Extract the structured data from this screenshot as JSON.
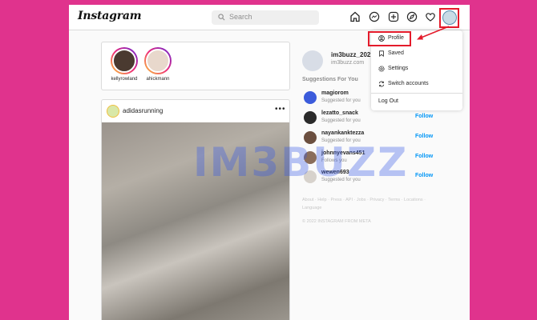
{
  "header": {
    "logo": "Instagram",
    "search_placeholder": "Search"
  },
  "stories": [
    {
      "name": "kellyrowland"
    },
    {
      "name": "ahickmann"
    }
  ],
  "post": {
    "username": "adidasrunning",
    "more": "•••"
  },
  "sidebar": {
    "username": "im3buzz_2021",
    "site": "im3buzz.com",
    "suggestions_title": "Suggestions For You",
    "suggestions": [
      {
        "username": "magiorom",
        "sub": "Suggested for you",
        "follow": "",
        "color": "#3b5bdb"
      },
      {
        "username": "lezatto_snack",
        "sub": "Suggested for you",
        "follow": "Follow",
        "color": "#2a2a2a"
      },
      {
        "username": "nayankanktezza",
        "sub": "Suggested for you",
        "follow": "Follow",
        "color": "#6b4f3f"
      },
      {
        "username": "johnnyevans451",
        "sub": "Follows you",
        "follow": "Follow",
        "color": "#8a6d5a"
      },
      {
        "username": "wewen693",
        "sub": "Suggested for you",
        "follow": "Follow",
        "color": "#d7d2cc"
      }
    ],
    "footer": "About · Help · Press · API · Jobs · Privacy · Terms · Locations · Language",
    "copyright": "© 2022 INSTAGRAM FROM META"
  },
  "menu": {
    "items": [
      {
        "label": "Profile",
        "icon": "profile-icon"
      },
      {
        "label": "Saved",
        "icon": "bookmark-icon"
      },
      {
        "label": "Settings",
        "icon": "gear-icon"
      },
      {
        "label": "Switch accounts",
        "icon": "switch-icon"
      }
    ],
    "logout": "Log Out"
  },
  "watermark": "IM3BUZZ",
  "colors": {
    "background": "#e0338d",
    "highlight": "#e41b2b",
    "link": "#0095f6"
  }
}
